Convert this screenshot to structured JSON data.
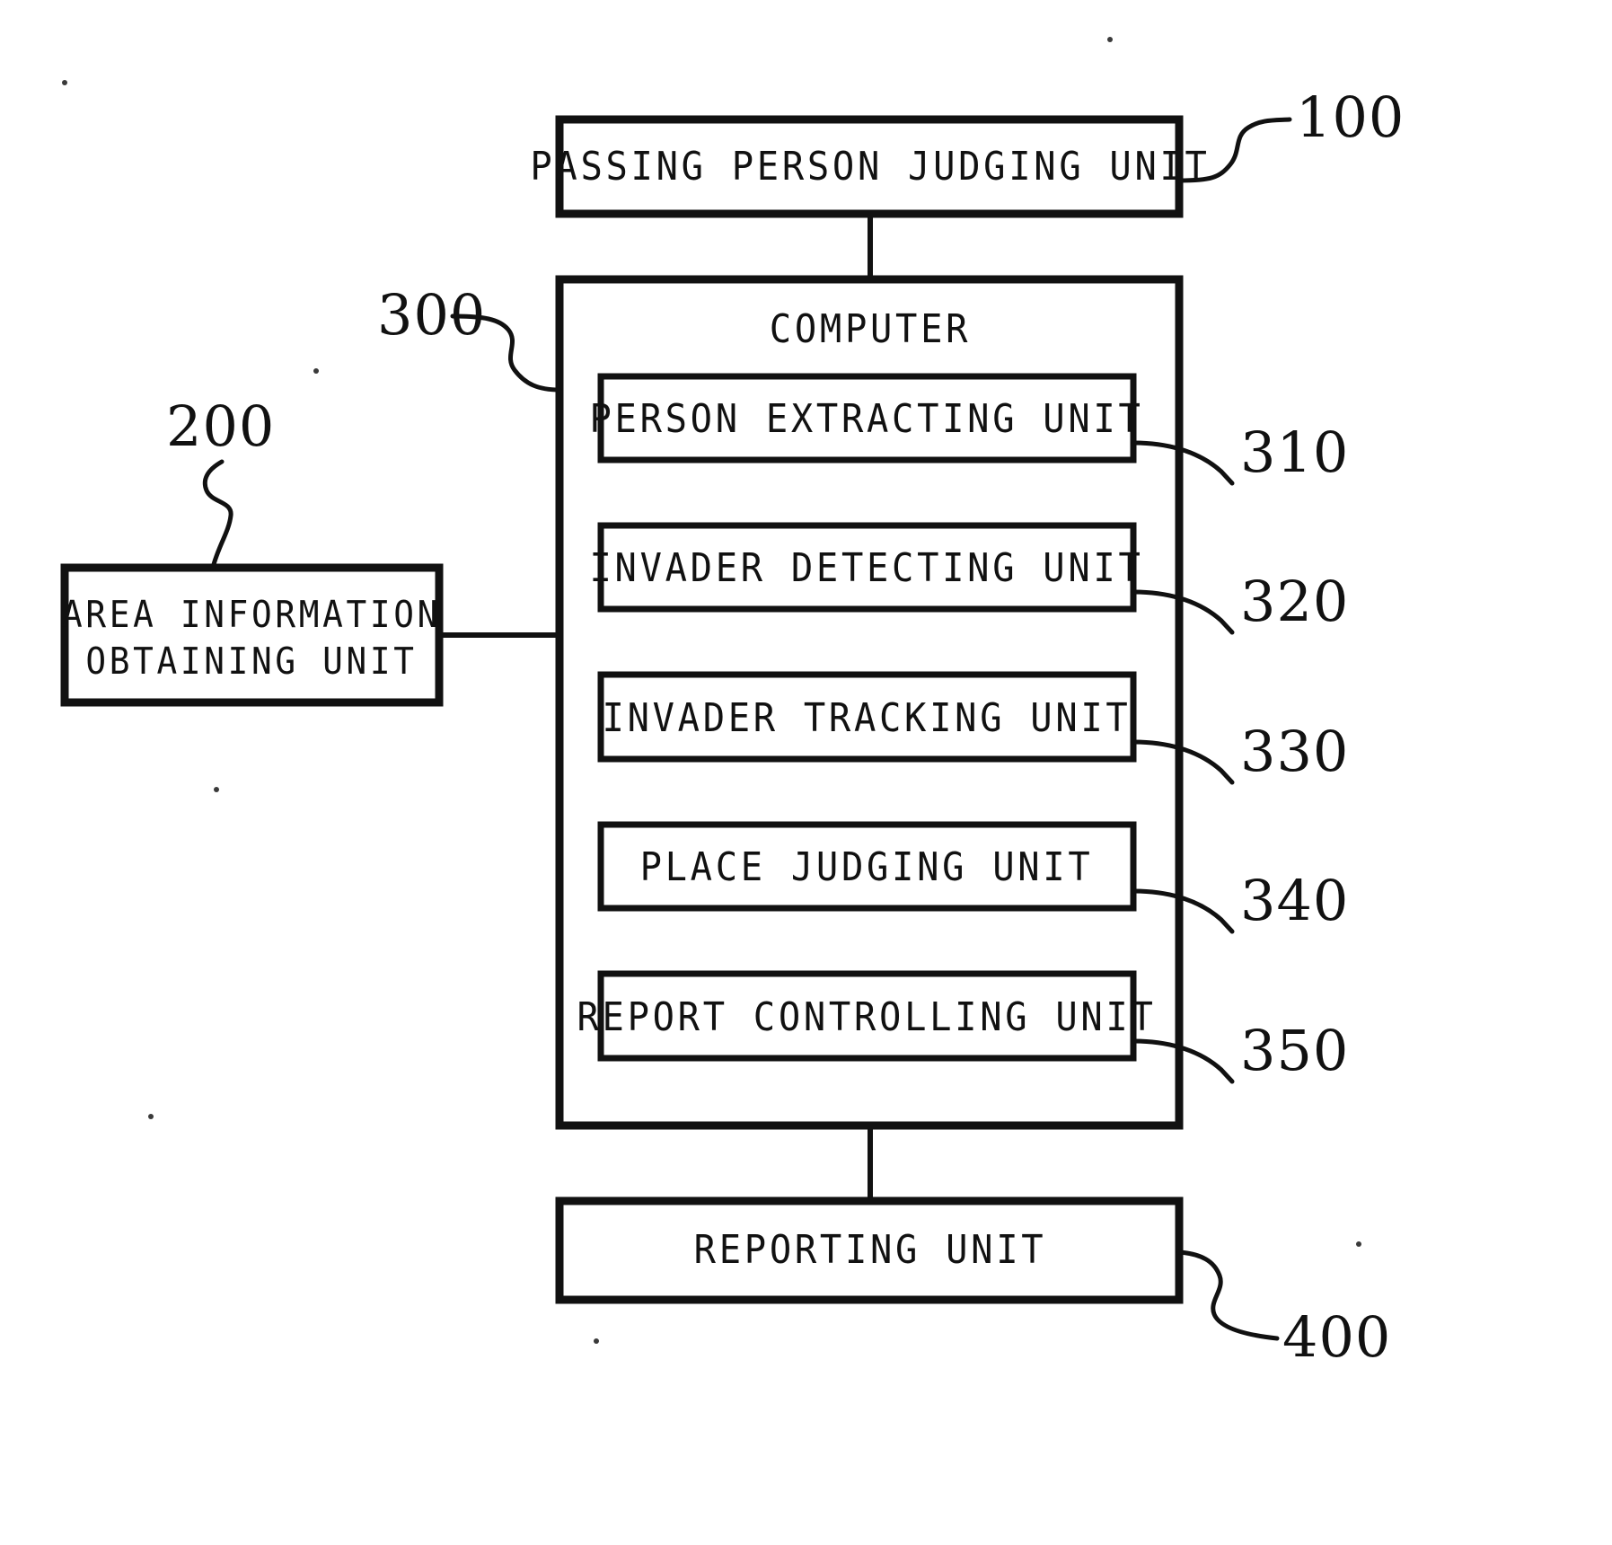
{
  "figure": {
    "kind": "patent-block-diagram",
    "background_color": "#ffffff",
    "line_color": "#111111"
  },
  "blocks": {
    "passing_person_judging_unit": {
      "label": "PASSING PERSON JUDGING UNIT",
      "ref": "100"
    },
    "computer": {
      "label": "COMPUTER",
      "ref": "300"
    },
    "area_information_obtaining_unit": {
      "label_line1": "AREA INFORMATION",
      "label_line2": "OBTAINING UNIT",
      "ref": "200"
    },
    "reporting_unit": {
      "label": "REPORTING UNIT",
      "ref": "400"
    }
  },
  "computer_units": [
    {
      "label": "PERSON EXTRACTING UNIT",
      "ref": "310"
    },
    {
      "label": "INVADER DETECTING UNIT",
      "ref": "320"
    },
    {
      "label": "INVADER TRACKING UNIT",
      "ref": "330"
    },
    {
      "label": "PLACE JUDGING UNIT",
      "ref": "340"
    },
    {
      "label": "REPORT CONTROLLING UNIT",
      "ref": "350"
    }
  ]
}
